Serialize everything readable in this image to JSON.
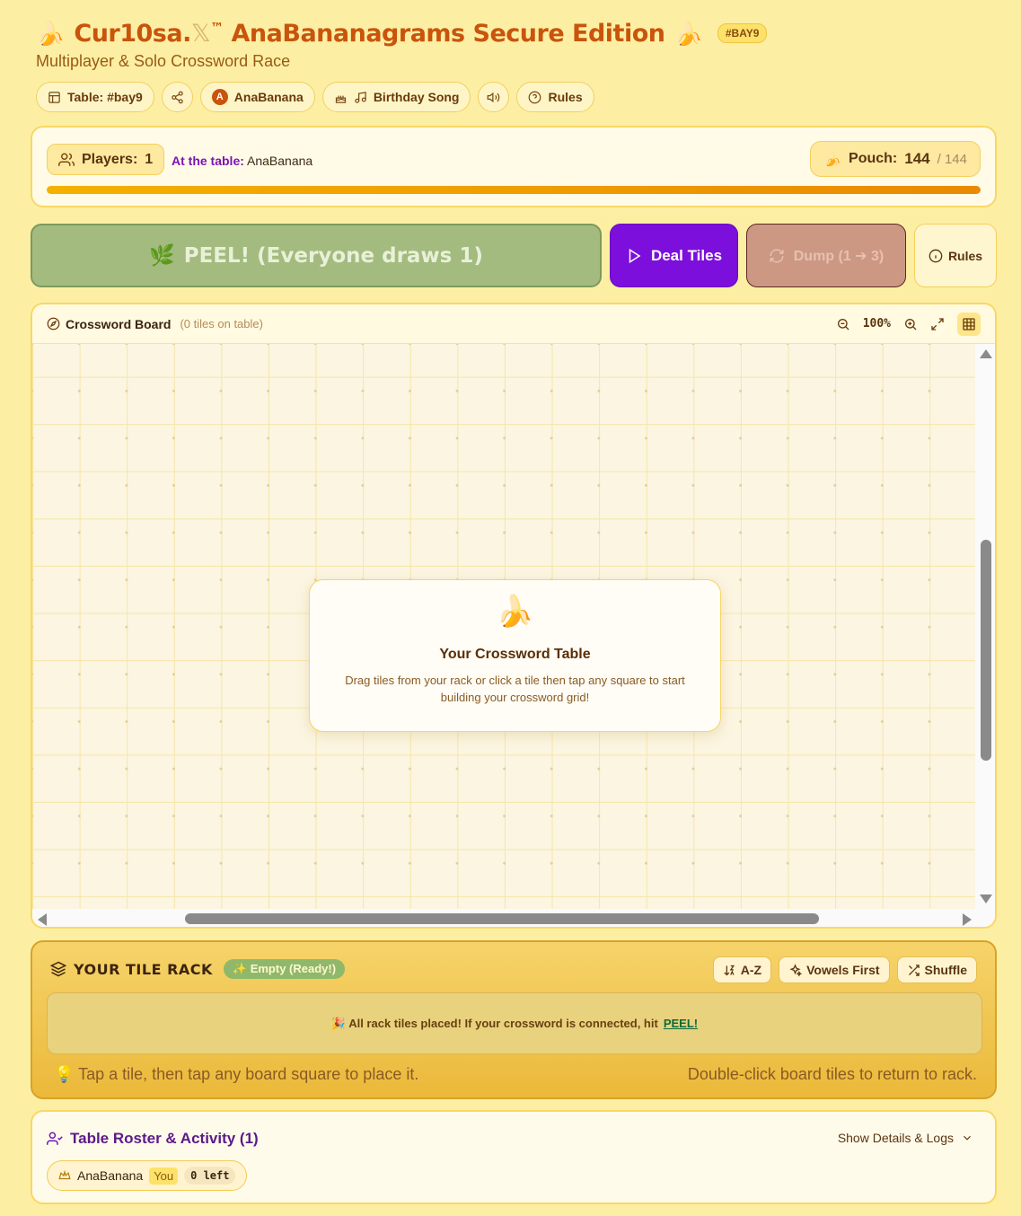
{
  "header": {
    "title_emoji_left": "🍌",
    "title_main": "Cur10sa.",
    "title_x": "𝕏",
    "title_tm": "™",
    "title_rest": "AnaBananagrams Secure Edition",
    "title_emoji_right": "🍌",
    "table_badge": "#BAY9",
    "subtitle": "Multiplayer & Solo Crossword Race",
    "pills": {
      "table": "Table: #bay9",
      "avatar_initial": "A",
      "user": "AnaBanana",
      "song": "Birthday Song",
      "rules": "Rules"
    }
  },
  "players": {
    "label": "Players:",
    "count": "1",
    "at_table_label": "At the table:",
    "at_table_names": "AnaBanana",
    "pouch_label": "Pouch:",
    "pouch_count": "144",
    "pouch_total": "/ 144",
    "pouch_fraction": 1.0
  },
  "actions": {
    "peel": "PEEL! (Everyone draws 1)",
    "deal": "Deal Tiles",
    "dump": "Dump (1 ➔ 3)",
    "rules": "Rules"
  },
  "board": {
    "title": "Crossword Board",
    "tile_count": "(0 tiles on table)",
    "zoom": "100%",
    "empty_emoji": "🍌",
    "empty_title": "Your Crossword Table",
    "empty_text": "Drag tiles from your rack or click a tile then tap any square to start building your crossword grid!"
  },
  "rack": {
    "title": "YOUR TILE RACK",
    "status": "✨ Empty (Ready!)",
    "sort_az": "A-Z",
    "vowels_first": "Vowels First",
    "shuffle": "Shuffle",
    "message_prefix": "🎉 All rack tiles placed! If your crossword is connected, hit",
    "message_link": "PEEL!",
    "hint_left": "💡 Tap a tile, then tap any board square to place it.",
    "hint_right": "Double-click board tiles to return to rack."
  },
  "roster": {
    "title": "Table Roster & Activity (1)",
    "toggle": "Show Details & Logs",
    "players": [
      {
        "name": "AnaBanana",
        "you": "You",
        "left": "0 left"
      }
    ]
  },
  "colors": {
    "background": "#fcefa4",
    "accent_purple": "#7c0fdb",
    "title_orange": "#c9540c",
    "peel_green": "#a3bb7f"
  }
}
